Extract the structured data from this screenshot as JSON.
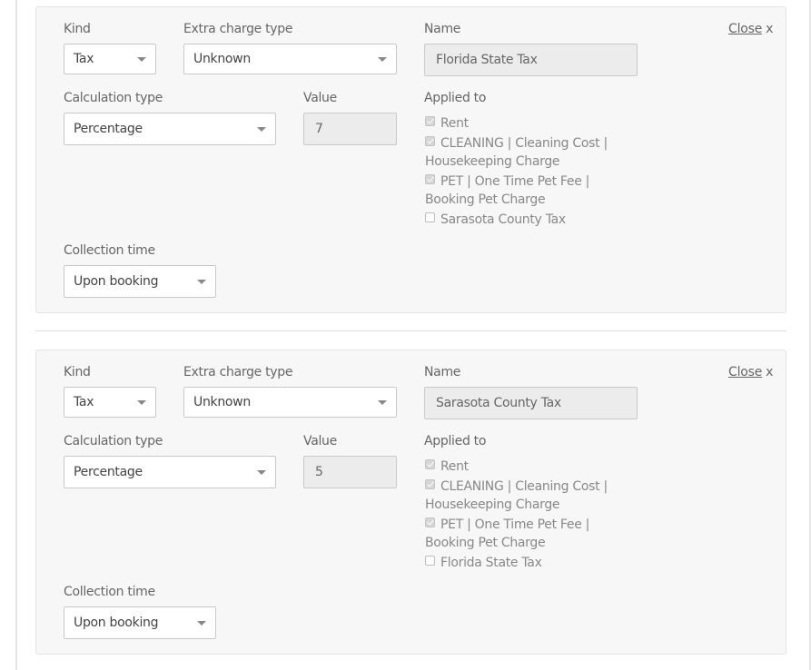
{
  "fees": [
    {
      "close_label": "Close",
      "close_x": "x",
      "kind": {
        "label": "Kind",
        "value": "Tax"
      },
      "extra_charge_type": {
        "label": "Extra charge type",
        "value": "Unknown"
      },
      "name": {
        "label": "Name",
        "value": "Florida State Tax"
      },
      "calculation_type": {
        "label": "Calculation type",
        "value": "Percentage"
      },
      "value": {
        "label": "Value",
        "value": "7"
      },
      "applied_to": {
        "label": "Applied to",
        "items": [
          {
            "line1": "Rent",
            "line2": "",
            "checked": true
          },
          {
            "line1": "CLEANING | Cleaning Cost |",
            "line2": "Housekeeping Charge",
            "checked": true
          },
          {
            "line1": "PET | One Time Pet Fee |",
            "line2": "Booking Pet Charge",
            "checked": true
          },
          {
            "line1": "Sarasota County Tax",
            "line2": "",
            "checked": false
          }
        ]
      },
      "collection_time": {
        "label": "Collection time",
        "value": "Upon booking"
      }
    },
    {
      "close_label": "Close",
      "close_x": "x",
      "kind": {
        "label": "Kind",
        "value": "Tax"
      },
      "extra_charge_type": {
        "label": "Extra charge type",
        "value": "Unknown"
      },
      "name": {
        "label": "Name",
        "value": "Sarasota County Tax"
      },
      "calculation_type": {
        "label": "Calculation type",
        "value": "Percentage"
      },
      "value": {
        "label": "Value",
        "value": "5"
      },
      "applied_to": {
        "label": "Applied to",
        "items": [
          {
            "line1": "Rent",
            "line2": "",
            "checked": true
          },
          {
            "line1": "CLEANING | Cleaning Cost |",
            "line2": "Housekeeping Charge",
            "checked": true
          },
          {
            "line1": "PET | One Time Pet Fee |",
            "line2": "Booking Pet Charge",
            "checked": true
          },
          {
            "line1": "Florida State Tax",
            "line2": "",
            "checked": false
          }
        ]
      },
      "collection_time": {
        "label": "Collection time",
        "value": "Upon booking"
      }
    }
  ]
}
